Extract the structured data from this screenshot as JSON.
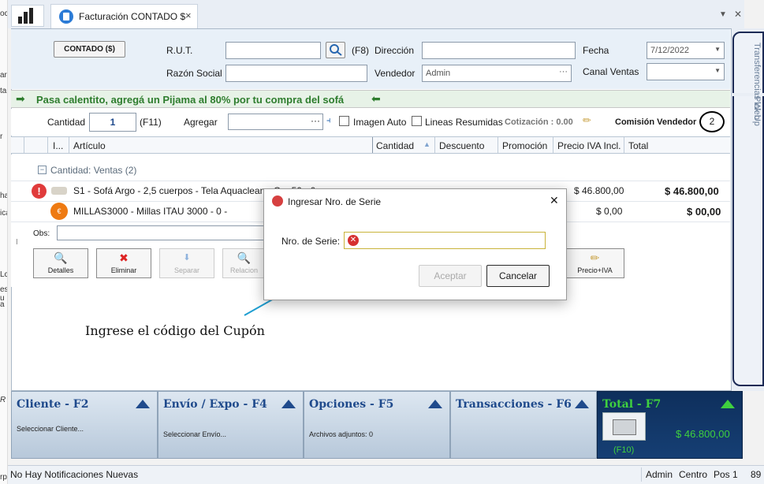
{
  "left_strip": {
    "lines": [
      "oc",
      "ar",
      "ta",
      "r",
      "ha",
      "ica",
      "Lc",
      "es u",
      "os n",
      "a",
      "R",
      "rp"
    ]
  },
  "tabs": {
    "active_label": "Facturación CONTADO $",
    "close": "×"
  },
  "window_controls": {
    "dropdown": "▼",
    "close": "✕"
  },
  "form": {
    "contado_button": "CONTADO ($)",
    "rut_label": "R.U.T.",
    "rut_value": "",
    "rut_shortcut": "(F8)",
    "direccion_label": "Dirección",
    "direccion_value": "",
    "fecha_label": "Fecha",
    "fecha_value": "7/12/2022",
    "razon_label": "Razón Social",
    "razon_value": "",
    "vendedor_label": "Vendedor",
    "vendedor_value": "Admin",
    "canal_label": "Canal Ventas",
    "canal_value": ""
  },
  "promo": {
    "text": "Pasa calentito, agregá un Pijama al 80% por tu compra del sofá"
  },
  "qty_row": {
    "cantidad_label": "Cantidad",
    "cantidad_value": "1",
    "cantidad_shortcut": "(F11)",
    "agregar_label": "Agregar",
    "agregar_value": "",
    "imagen_auto": "Imagen Auto",
    "lineas_resumidas": "Lineas Resumidas",
    "cotizacion": "Cotización : 0.00",
    "comision_label": "Comisión Vendedor",
    "comision_value": "2"
  },
  "grid": {
    "headers": [
      "I...",
      "Artículo",
      "Cantidad",
      "Descuento",
      "Promoción",
      "Precio IVA Incl.",
      "Total"
    ],
    "group_label": "Cantidad: Ventas (2)",
    "rows": [
      {
        "article": "S1 - Sofá Argo - 2,5 cuerpos - Tela Aquaclean - Gr.. 50 - 0",
        "price": "$ 46.800,00",
        "total": "$ 46.800,00"
      },
      {
        "article": "MILLAS3000 - Millas ITAU 3000 - 0 -",
        "price": "$ 0,00",
        "total": "$ 00,00"
      }
    ],
    "obs_label": "Obs:"
  },
  "actions": [
    {
      "label": "Detalles",
      "icon": "magnifier-icon",
      "glyph": "🔍"
    },
    {
      "label": "Eliminar",
      "icon": "delete-x-icon",
      "glyph": "✖"
    },
    {
      "label": "Separar",
      "icon": "arrow-down-icon",
      "glyph": "⬇"
    },
    {
      "label": "Relacion",
      "icon": "magnifier-icon",
      "glyph": "🔍"
    }
  ],
  "precio_iva_button": {
    "label": "Precio+IVA",
    "glyph": "✏"
  },
  "modal": {
    "title": "Ingresar Nro. de Serie",
    "field_label": "Nro. de Serie:",
    "field_value": "",
    "accept": "Aceptar",
    "cancel": "Cancelar",
    "close": "✕"
  },
  "annotation": "Ingrese el código del Cupón",
  "bottom_panels": [
    {
      "title": "Cliente - F2",
      "sub": "Seleccionar Cliente..."
    },
    {
      "title": "Envío / Expo - F4",
      "sub": "Seleccionar Envío..."
    },
    {
      "title": "Opciones - F5",
      "sub": "Archivos adjuntos: 0"
    },
    {
      "title": "Transacciones - F6",
      "sub": ""
    }
  ],
  "total_panel": {
    "title": "Total - F7",
    "amount": "$ 46.800,00",
    "shortcut": "(F10)"
  },
  "right_tabs": {
    "transferencias": "Transferencias Web",
    "pickup": "Pick Up"
  },
  "status": {
    "notifications": "No Hay Notificaciones Nuevas",
    "user": "Admin",
    "location": "Centro",
    "pos": "Pos 1",
    "num": "89"
  },
  "colors": {
    "promo_green": "#2e7d2e",
    "title_blue": "#1f4a8c",
    "total_bg": "#0e2f5c",
    "total_green": "#3fd03f",
    "arrow": "#1f9ed1"
  }
}
